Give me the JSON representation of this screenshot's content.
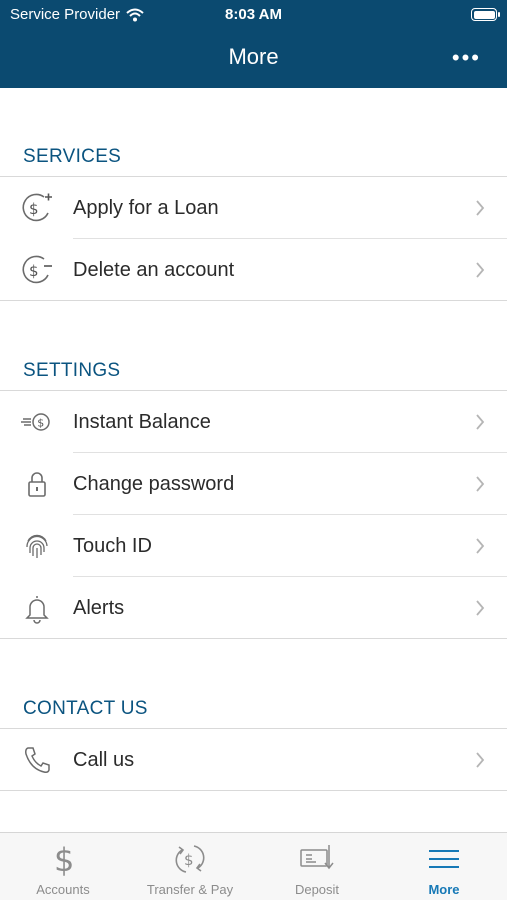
{
  "status_bar": {
    "carrier": "Service Provider",
    "time": "8:03 AM",
    "battery_level": 1.0,
    "wifi_icon": "wifi-icon",
    "battery_icon": "battery-icon"
  },
  "nav": {
    "title": "More",
    "menu_icon": "more-horizontal-icon"
  },
  "sections": {
    "services": {
      "title": "SERVICES",
      "items": [
        {
          "label": "Apply for a Loan",
          "icon": "dollar-plus-icon"
        },
        {
          "label": "Delete an account",
          "icon": "dollar-minus-icon"
        }
      ]
    },
    "settings": {
      "title": "SETTINGS",
      "items": [
        {
          "label": "Instant Balance",
          "icon": "instant-balance-icon"
        },
        {
          "label": "Change password",
          "icon": "lock-icon"
        },
        {
          "label": "Touch ID",
          "icon": "fingerprint-icon"
        },
        {
          "label": "Alerts",
          "icon": "bell-icon"
        }
      ]
    },
    "contact": {
      "title": "CONTACT US",
      "items": [
        {
          "label": "Call us",
          "icon": "phone-icon"
        }
      ]
    }
  },
  "tabbar": {
    "tabs": [
      {
        "label": "Accounts",
        "icon": "dollar-icon",
        "active": false
      },
      {
        "label": "Transfer & Pay",
        "icon": "transfer-dollar-icon",
        "active": false
      },
      {
        "label": "Deposit",
        "icon": "check-deposit-icon",
        "active": false
      },
      {
        "label": "More",
        "icon": "menu-lines-icon",
        "active": true
      }
    ]
  },
  "colors": {
    "header_bg": "#0b4a70",
    "section_title": "#0b5480",
    "tab_active": "#1779b6",
    "tab_inactive": "#8c8c8c"
  }
}
